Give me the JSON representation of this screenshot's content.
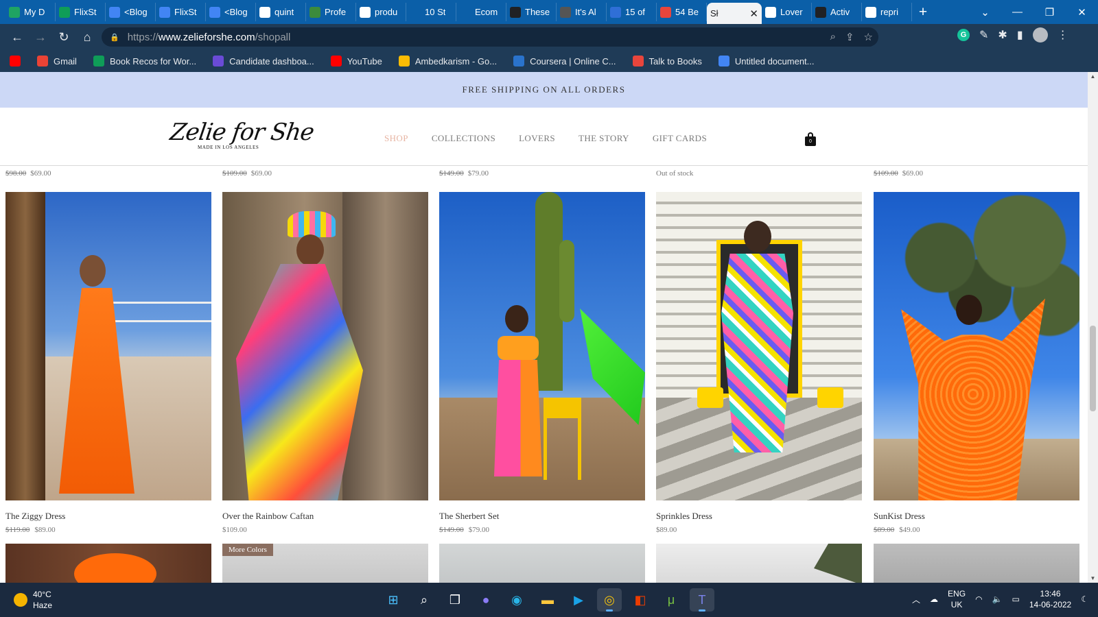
{
  "browser": {
    "tabs": [
      {
        "label": "My D",
        "icon": "google-drive-icon",
        "color": "#1fa463"
      },
      {
        "label": "FlixSt",
        "icon": "google-sheets-icon",
        "color": "#0f9d58"
      },
      {
        "label": "<Blog",
        "icon": "google-docs-icon",
        "color": "#4285f4"
      },
      {
        "label": "FlixSt",
        "icon": "google-docs-icon",
        "color": "#4285f4"
      },
      {
        "label": "<Blog",
        "icon": "google-docs-icon",
        "color": "#4285f4"
      },
      {
        "label": "quint",
        "icon": "google-icon",
        "color": "#ffffff"
      },
      {
        "label": "Profe",
        "icon": "site-icon",
        "color": "#3c8b3c"
      },
      {
        "label": "produ",
        "icon": "google-icon",
        "color": "#ffffff"
      },
      {
        "label": "10 St",
        "icon": "p-icon",
        "color": "#0b5fa8"
      },
      {
        "label": "Ecom",
        "icon": "bracket-icon",
        "color": "#0b5fa8"
      },
      {
        "label": "These",
        "icon": "camera-icon",
        "color": "#202124"
      },
      {
        "label": "It's Al",
        "icon": "column-icon",
        "color": "#555555"
      },
      {
        "label": "15 of",
        "icon": "site-icon",
        "color": "#2f6fd6"
      },
      {
        "label": "54 Be",
        "icon": "c-icon",
        "color": "#e8453c"
      },
      {
        "label": "Sł",
        "icon": "",
        "color": "#f2f3f5",
        "active": true
      },
      {
        "label": "Lover",
        "icon": "r-icon",
        "color": "#ffffff"
      },
      {
        "label": "Activ",
        "icon": "v-icon",
        "color": "#202124"
      },
      {
        "label": "repri",
        "icon": "google-icon",
        "color": "#ffffff"
      }
    ],
    "address": {
      "prefix": "https://",
      "host": "www.zelieforshe.com",
      "path": "/shopall"
    },
    "bookmarks": [
      {
        "label": "",
        "icon": "youtube-icon",
        "color": "#ff0000"
      },
      {
        "label": "Gmail",
        "icon": "gmail-icon",
        "color": "#ea4335"
      },
      {
        "label": "Book Recos for Wor...",
        "icon": "google-sheets-icon",
        "color": "#0f9d58"
      },
      {
        "label": "Candidate dashboa...",
        "icon": "site-icon",
        "color": "#6a4bd6"
      },
      {
        "label": "YouTube",
        "icon": "youtube-icon",
        "color": "#ff0000"
      },
      {
        "label": "Ambedkarism - Go...",
        "icon": "google-drive-icon",
        "color": "#fbbc04"
      },
      {
        "label": "Coursera | Online C...",
        "icon": "coursera-icon",
        "color": "#2a73cc"
      },
      {
        "label": "Talk to Books",
        "icon": "books-icon",
        "color": "#e8453c"
      },
      {
        "label": "Untitled document...",
        "icon": "google-docs-icon",
        "color": "#4285f4"
      }
    ]
  },
  "site": {
    "announcement": "FREE SHIPPING ON ALL ORDERS",
    "logo_script": "Zelie for She",
    "logo_tagline": "MADE IN LOS ANGELES",
    "nav": [
      "SHOP",
      "COLLECTIONS",
      "LOVERS",
      "THE STORY",
      "GIFT CARDS"
    ],
    "cart_count": "0",
    "accent_color": "#e7b4a2"
  },
  "previous_row": [
    {
      "old": "$98.00",
      "price": "$69.00"
    },
    {
      "old": "$109.00",
      "price": "$69.00"
    },
    {
      "old": "$149.00",
      "price": "$79.00"
    },
    {
      "old": "",
      "price": "Out of stock"
    },
    {
      "old": "$109.00",
      "price": "$69.00"
    }
  ],
  "products": [
    {
      "name": "The Ziggy Dress",
      "old": "$119.00",
      "price": "$89.00"
    },
    {
      "name": "Over the Rainbow Caftan",
      "old": "",
      "price": "$109.00"
    },
    {
      "name": "The Sherbert Set",
      "old": "$149.00",
      "price": "$79.00"
    },
    {
      "name": "Sprinkles Dress",
      "old": "",
      "price": "$89.00"
    },
    {
      "name": "SunKist Dress",
      "old": "$89.00",
      "price": "$49.00"
    }
  ],
  "next_row_badge": "More Colors",
  "taskbar": {
    "temp": "40°C",
    "condition": "Haze",
    "lang1": "ENG",
    "lang2": "UK",
    "time": "13:46",
    "date": "14-06-2022"
  }
}
